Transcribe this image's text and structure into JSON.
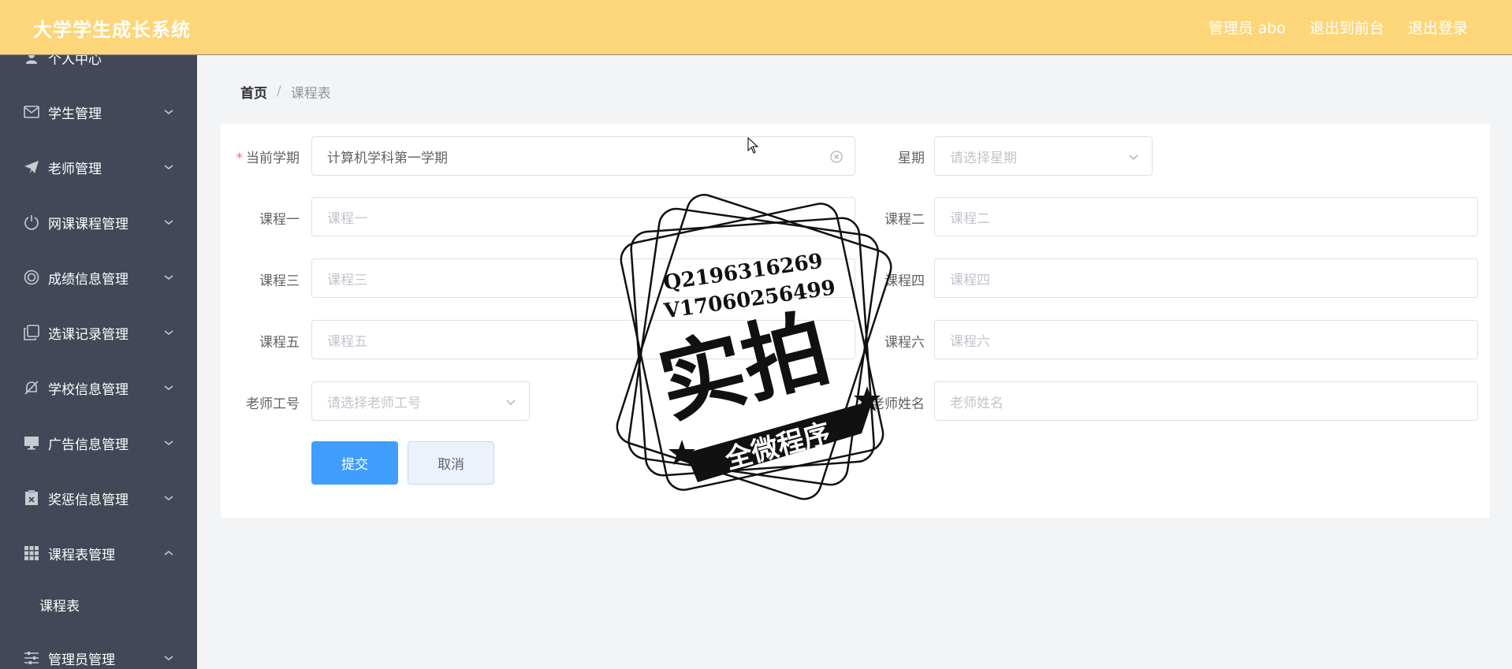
{
  "header": {
    "app_title": "大学学生成长系统",
    "links": [
      "管理员 abo",
      "退出到前台",
      "退出登录"
    ]
  },
  "sidebar": {
    "partial_top_label": "个人中心",
    "items": [
      {
        "label": "学生管理",
        "icon": "mail-icon"
      },
      {
        "label": "老师管理",
        "icon": "send-icon"
      },
      {
        "label": "网课课程管理",
        "icon": "power-icon"
      },
      {
        "label": "成绩信息管理",
        "icon": "target-icon"
      },
      {
        "label": "选课记录管理",
        "icon": "copy-icon"
      },
      {
        "label": "学校信息管理",
        "icon": "bell-off-icon"
      },
      {
        "label": "广告信息管理",
        "icon": "monitor-icon"
      },
      {
        "label": "奖惩信息管理",
        "icon": "clipboard-x-icon"
      },
      {
        "label": "课程表管理",
        "icon": "grid-icon"
      },
      {
        "label": "管理员管理",
        "icon": "sliders-icon"
      }
    ],
    "sub_item": "课程表"
  },
  "breadcrumb": {
    "home": "首页",
    "separator": "/",
    "current": "课程表"
  },
  "form": {
    "semester": {
      "label": "当前学期",
      "required_mark": "*",
      "value": "计算机学科第一学期"
    },
    "weekday": {
      "label": "星期",
      "placeholder": "请选择星期"
    },
    "course1": {
      "label": "课程一",
      "placeholder": "课程一"
    },
    "course2": {
      "label": "课程二",
      "placeholder": "课程二"
    },
    "course3": {
      "label": "课程三",
      "placeholder": "课程三"
    },
    "course4": {
      "label": "课程四",
      "placeholder": "课程四"
    },
    "course5": {
      "label": "课程五",
      "placeholder": "课程五"
    },
    "course6": {
      "label": "课程六",
      "placeholder": "课程六"
    },
    "teacher_id": {
      "label": "老师工号",
      "placeholder": "请选择老师工号"
    },
    "teacher_name": {
      "label": "老师姓名",
      "placeholder": "老师姓名"
    },
    "submit_label": "提交",
    "cancel_label": "取消"
  },
  "watermark": {
    "line1": "Q2196316269",
    "line2": "V17060256499",
    "main": "实拍",
    "ribbon": "全微程序"
  },
  "colors": {
    "header_bg": "#fdd67a",
    "sidebar_bg": "#424857",
    "primary": "#409eff",
    "required": "#f56c6c"
  }
}
